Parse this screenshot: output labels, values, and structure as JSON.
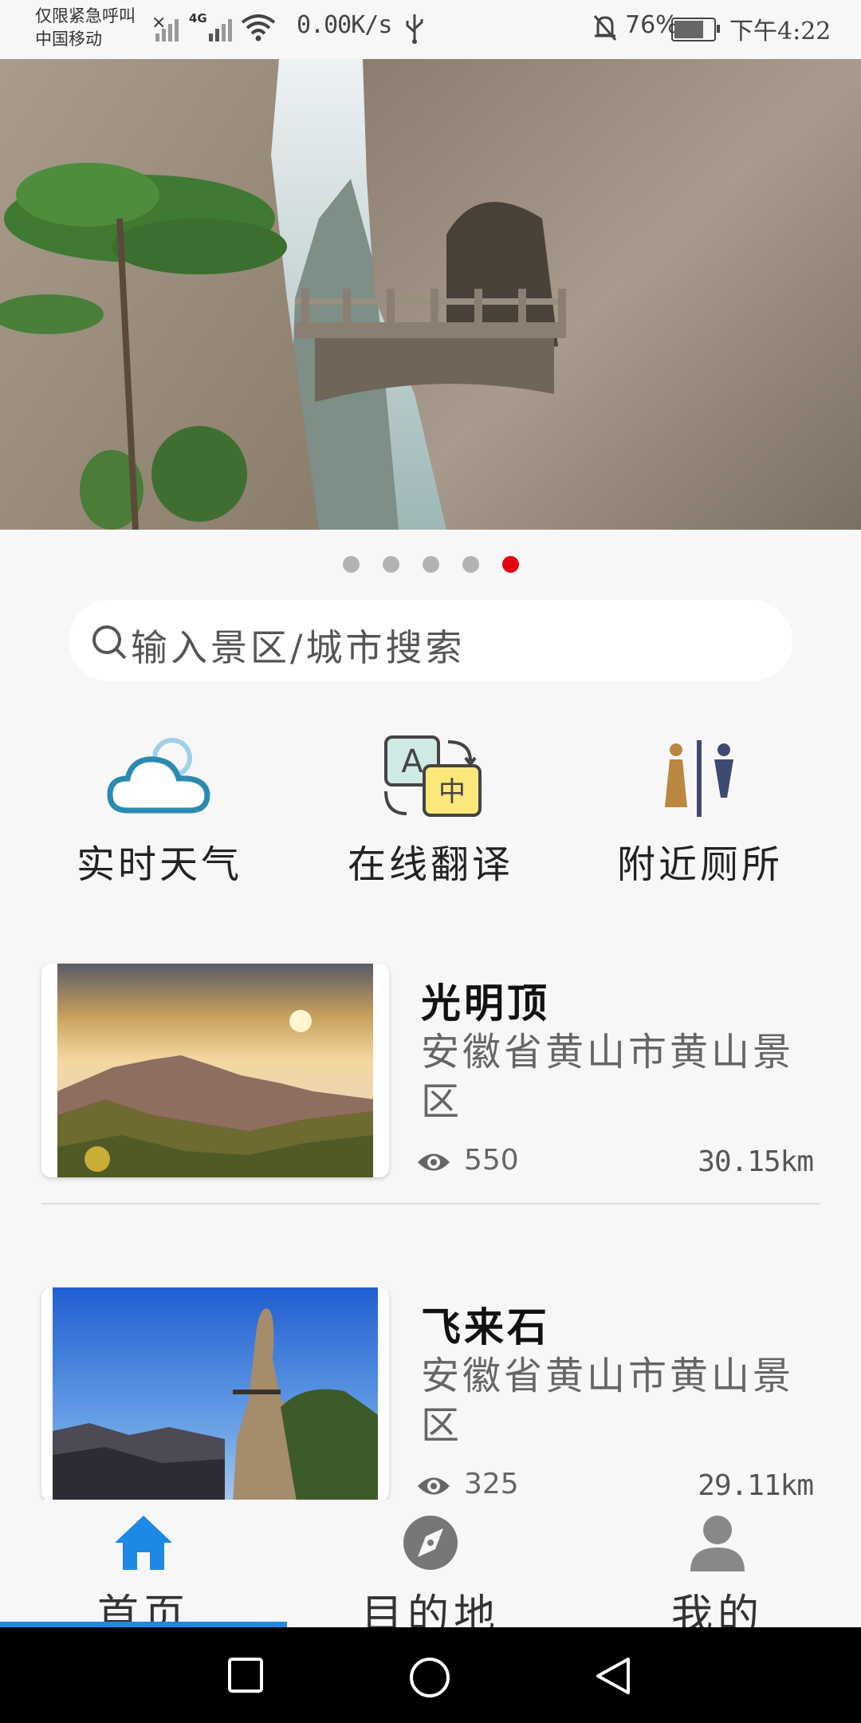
{
  "status_bar": {
    "carrier_line1": "仅限紧急呼叫",
    "carrier_line2": "中国移动",
    "network": "4G",
    "speed": "0.00K/s",
    "battery": "76%",
    "time": "下午4:22"
  },
  "banner": {
    "slide_count": 5,
    "active_index": 4
  },
  "search": {
    "placeholder": "输入景区/城市搜索"
  },
  "quick_actions": [
    {
      "label": "实时天气",
      "icon": "weather-cloud-icon"
    },
    {
      "label": "在线翻译",
      "icon": "translate-icon"
    },
    {
      "label": "附近厕所",
      "icon": "restroom-icon"
    }
  ],
  "spots": [
    {
      "name": "光明顶",
      "address": "安徽省黄山市黄山景区",
      "views": "550",
      "distance": "30.15km"
    },
    {
      "name": "飞来石",
      "address": "安徽省黄山市黄山景区",
      "views": "325",
      "distance": "29.11km"
    }
  ],
  "tabs": [
    {
      "label": "首页",
      "active": true
    },
    {
      "label": "目的地",
      "active": false
    },
    {
      "label": "我的",
      "active": false
    }
  ],
  "colors": {
    "accent": "#1e88e5",
    "dot_active": "#e60012"
  }
}
